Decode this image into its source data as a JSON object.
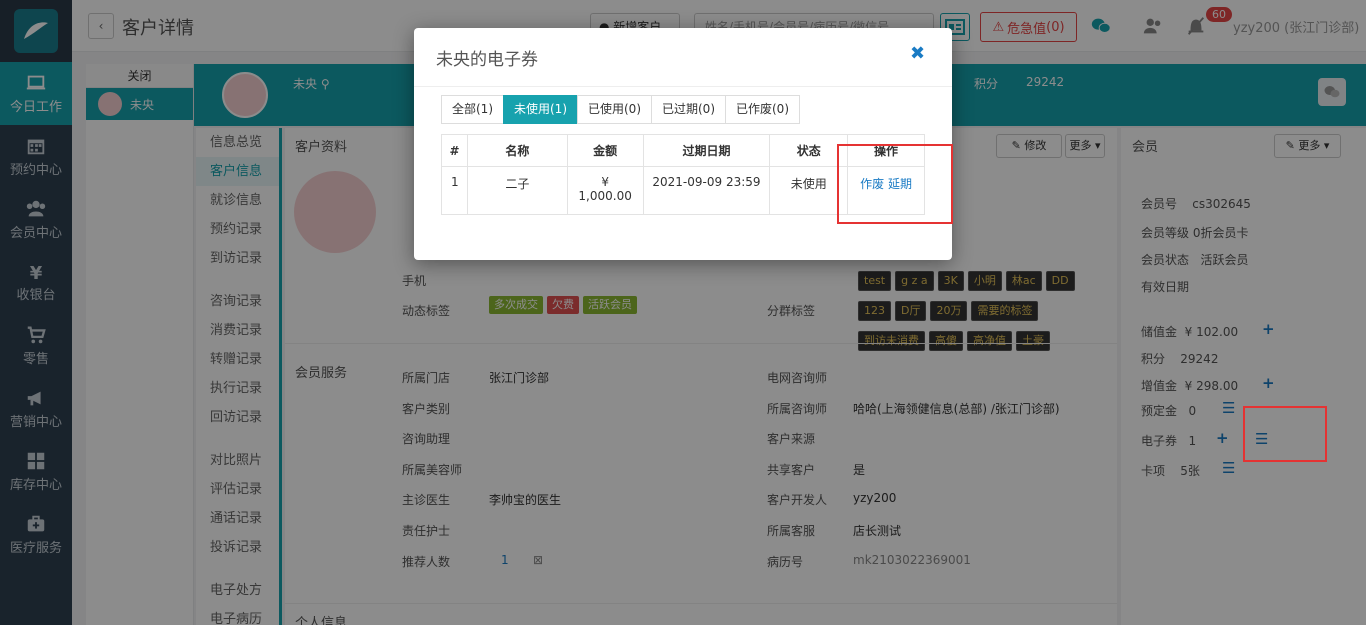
{
  "sidebar": {
    "items": [
      {
        "label": "今日工作",
        "icon": "laptop-icon"
      },
      {
        "label": "预约中心",
        "icon": "calendar-icon"
      },
      {
        "label": "会员中心",
        "icon": "users-icon"
      },
      {
        "label": "收银台",
        "icon": "yen-icon"
      },
      {
        "label": "零售",
        "icon": "cart-icon"
      },
      {
        "label": "营销中心",
        "icon": "megaphone-icon"
      },
      {
        "label": "库存中心",
        "icon": "grid-icon"
      },
      {
        "label": "医疗服务",
        "icon": "medkit-icon"
      }
    ]
  },
  "header": {
    "title": "客户详情",
    "new_customer": "新增客户",
    "search_placeholder": "姓名/手机号/会员号/病历号/微信号",
    "danger_label": "危急值",
    "danger_count": "0",
    "notif_count": "60",
    "user": "yzy200 (张江门诊部)"
  },
  "tabs": {
    "close": "关闭",
    "customer": "未央"
  },
  "band": {
    "name": "未央",
    "points_label": "积分",
    "points_value": "29242"
  },
  "subnav": [
    "信息总览",
    "客户信息",
    "就诊信息",
    "预约记录",
    "到访记录",
    "咨询记录",
    "消费记录",
    "转赠记录",
    "执行记录",
    "回访记录",
    "对比照片",
    "评估记录",
    "通话记录",
    "投诉记录",
    "电子处方",
    "电子病历"
  ],
  "profile": {
    "title": "客户资料",
    "edit": "修改",
    "more": "更多",
    "phone_label": "手机",
    "dynamic_tags_label": "动态标签",
    "dynamic_tags": [
      {
        "text": "多次成交",
        "color": "#8bb932"
      },
      {
        "text": "欠费",
        "color": "#e05050"
      },
      {
        "text": "活跃会员",
        "color": "#8bb932"
      }
    ],
    "top_tags": [
      "test",
      "g z a",
      "3K",
      "小明",
      "林ac",
      "DD"
    ],
    "group_tags_label": "分群标签",
    "group_tags_row1": [
      "123",
      "D厅",
      "20万",
      "需要的标签"
    ],
    "group_tags_row2": [
      "到访未消费",
      "高傻",
      "高净值",
      "土豪"
    ]
  },
  "member_service": {
    "title": "会员服务",
    "left": [
      {
        "label": "所属门店",
        "value": "张江门诊部"
      },
      {
        "label": "客户类别",
        "value": ""
      },
      {
        "label": "咨询助理",
        "value": ""
      },
      {
        "label": "所属美容师",
        "value": ""
      },
      {
        "label": "主诊医生",
        "value": "李帅宝的医生"
      },
      {
        "label": "责任护士",
        "value": ""
      },
      {
        "label": "推荐人数",
        "value": "1"
      }
    ],
    "right": [
      {
        "label": "电网咨询师",
        "value": ""
      },
      {
        "label": "所属咨询师",
        "value": "哈哈(上海领健信息(总部) /张江门诊部)"
      },
      {
        "label": "客户来源",
        "value": ""
      },
      {
        "label": "共享客户",
        "value": "是"
      },
      {
        "label": "客户开发人",
        "value": "yzy200"
      },
      {
        "label": "所属客服",
        "value": "店长测试"
      },
      {
        "label": "病历号",
        "value": "mk2103022369001"
      }
    ],
    "personal_info": "个人信息"
  },
  "member_panel": {
    "title": "会员",
    "more": "更多",
    "member_no_label": "会员号",
    "member_no": "cs302645",
    "level_label": "会员等级",
    "level": "0折会员卡",
    "status_label": "会员状态",
    "status": "活跃会员",
    "valid_label": "有效日期",
    "stored_label": "储值金",
    "stored": "¥ 102.00",
    "points_label": "积分",
    "points": "29242",
    "bonus_label": "增值金",
    "bonus": "¥ 298.00",
    "deposit_label": "预定金",
    "deposit": "0",
    "coupon_label": "电子券",
    "coupon": "1",
    "card_label": "卡项",
    "card": "5张"
  },
  "modal": {
    "title": "未央的电子券",
    "tabs": [
      "全部(1)",
      "未使用(1)",
      "已使用(0)",
      "已过期(0)",
      "已作废(0)"
    ],
    "active_tab": 1,
    "columns": [
      "#",
      "名称",
      "金额",
      "过期日期",
      "状态",
      "操作"
    ],
    "rows": [
      {
        "idx": "1",
        "name": "二子",
        "amount_sym": "¥",
        "amount": "1,000.00",
        "expire": "2021-09-09 23:59",
        "status": "未使用",
        "act1": "作废",
        "act2": "延期"
      }
    ]
  },
  "colors": {
    "accent": "#17a2ae",
    "sidebar": "#2f4050",
    "highlight": "#e53333",
    "link": "#1a7bc4"
  }
}
